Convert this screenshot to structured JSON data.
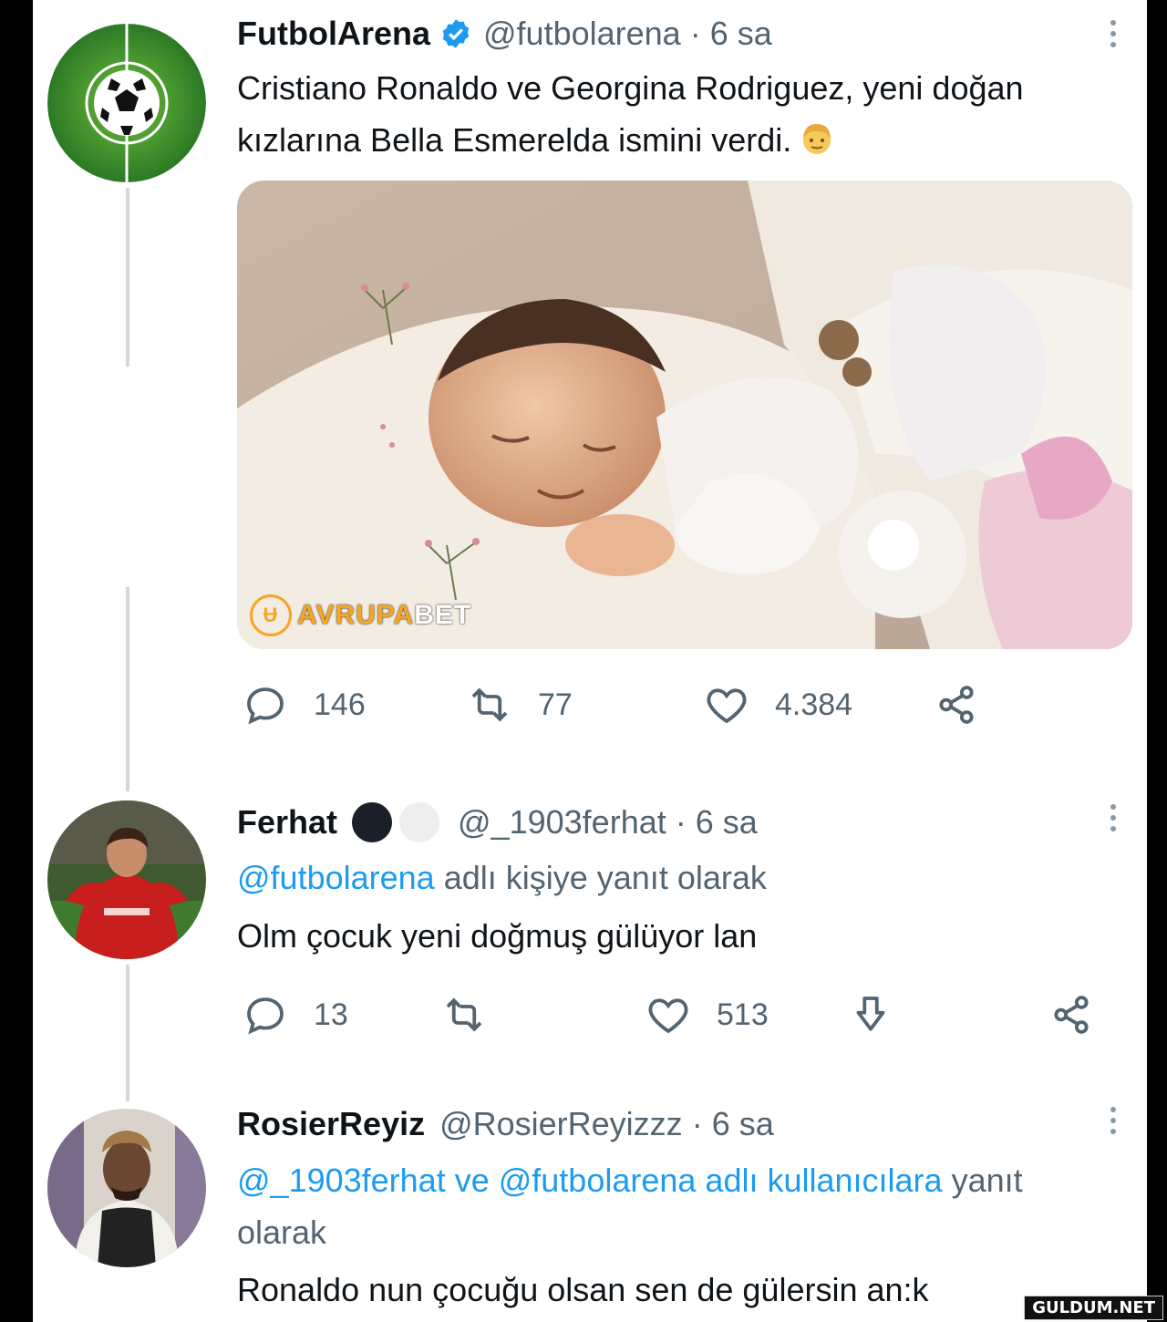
{
  "colors": {
    "accent": "#1d9bf0",
    "text": "#0f1419",
    "secondary": "#536471",
    "verified": "#1d9bf0"
  },
  "tweets": [
    {
      "name": "FutbolArena",
      "verified": true,
      "handle": "@futbolarena",
      "time": "6 sa",
      "text": "Cristiano Ronaldo ve Georgina Rodriguez, yeni doğan kızlarına Bella Esmerelda ismini verdi.",
      "emoji_icon": "person-blond-hair-icon",
      "stats": {
        "replies": "146",
        "retweets": "77",
        "likes": "4.384"
      }
    },
    {
      "name": "Ferhat",
      "handle": "@_1903ferhat",
      "time": "6 sa",
      "reply_mention": "@futbolarena",
      "reply_suffix": "adlı kişiye yanıt olarak",
      "text": "Olm çocuk yeni doğmuş gülüyor lan",
      "stats": {
        "replies": "13",
        "likes": "513"
      }
    },
    {
      "name": "RosierReyiz",
      "handle": "@RosierReyizzz",
      "time": "6 sa",
      "reply_mention": "@_1903ferhat ve @futbolarena adlı kullanıcılara",
      "reply_suffix": "yanıt",
      "reply_line2": "olarak",
      "text": "Ronaldo nun çocuğu olsan sen de gülersin an:k"
    }
  ],
  "watermark": {
    "part1": "AVRUPA",
    "part2": "BET"
  },
  "site_logo": "GULDUM.NET"
}
